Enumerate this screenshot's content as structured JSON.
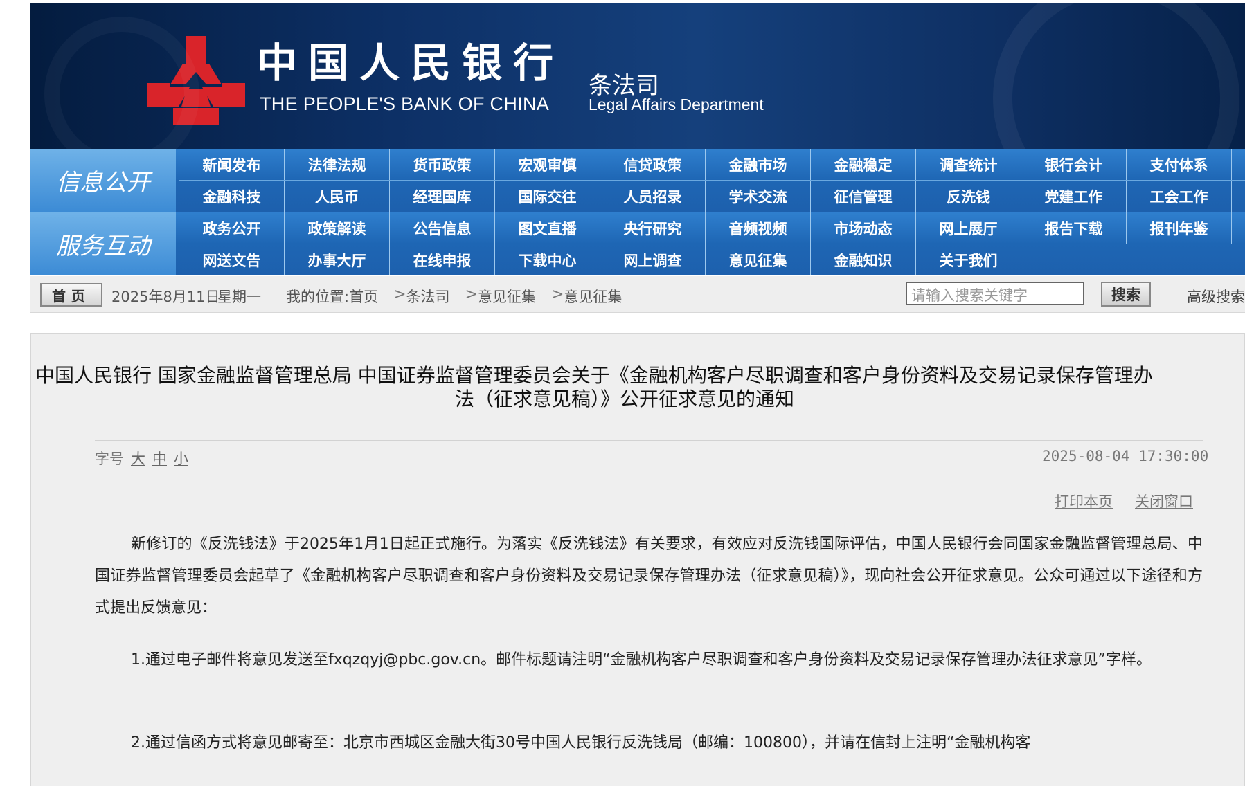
{
  "banner": {
    "bank_name_cn": "中国人民银行",
    "bank_name_en": "THE PEOPLE'S BANK OF CHINA",
    "dept_name_cn": "条法司",
    "dept_name_en": "Legal Affairs Department",
    "emblem_color": "#d9242a"
  },
  "nav": {
    "info_label": "信息公开",
    "service_label": "服务互动",
    "info_row1": [
      "新闻发布",
      "法律法规",
      "货币政策",
      "宏观审慎",
      "信贷政策",
      "金融市场",
      "金融稳定",
      "调查统计",
      "银行会计",
      "支付体系"
    ],
    "info_row2": [
      "金融科技",
      "人民币",
      "经理国库",
      "国际交往",
      "人员招录",
      "学术交流",
      "征信管理",
      "反洗钱",
      "党建工作",
      "工会工作"
    ],
    "service_row1": [
      "政务公开",
      "政策解读",
      "公告信息",
      "图文直播",
      "央行研究",
      "音频视频",
      "市场动态",
      "网上展厅",
      "报告下载",
      "报刊年鉴"
    ],
    "service_row2": [
      "网送文告",
      "办事大厅",
      "在线申报",
      "下载中心",
      "网上调查",
      "意见征集",
      "金融知识",
      "关于我们"
    ]
  },
  "breadcrumb": {
    "home_label": "首页",
    "date": "2025年8月11日",
    "weekday": "星期一",
    "location": "我的位置:首页",
    "path": [
      "条法司",
      "意见征集",
      "意见征集"
    ],
    "separator": ">",
    "search_placeholder": "请输入搜索关键字",
    "search_button": "搜索",
    "advanced_search": "高级搜索"
  },
  "article": {
    "title_line1": "中国人民银行 国家金融监督管理总局 中国证券监督管理委员会关于《金融机构客户尽职调查和客户身份资料及交易记录保存管理办",
    "title_line2": "法（征求意见稿）》公开征求意见的通知",
    "font_size_label": "字号",
    "font_large": "大",
    "font_medium": "中",
    "font_small": "小",
    "timestamp": "2025-08-04 17:30:00",
    "print_label": "打印本页",
    "close_label": "关闭窗口",
    "paragraph1": "新修订的《反洗钱法》于2025年1月1日起正式施行。为落实《反洗钱法》有关要求，有效应对反洗钱国际评估，中国人民银行会同国家金融监督管理总局、中国证券监督管理委员会起草了《金融机构客户尽职调查和客户身份资料及交易记录保存管理办法（征求意见稿）》，现向社会公开征求意见。公众可通过以下途径和方式提出反馈意见：",
    "paragraph2": "1.通过电子邮件将意见发送至fxqzqyj@pbc.gov.cn。邮件标题请注明“金融机构客户尽职调查和客户身份资料及交易记录保存管理办法征求意见”字样。",
    "paragraph3": "2.通过信函方式将意见邮寄至：北京市西城区金融大街30号中国人民银行反洗钱局（邮编：100800），并请在信封上注明“金融机构客"
  }
}
